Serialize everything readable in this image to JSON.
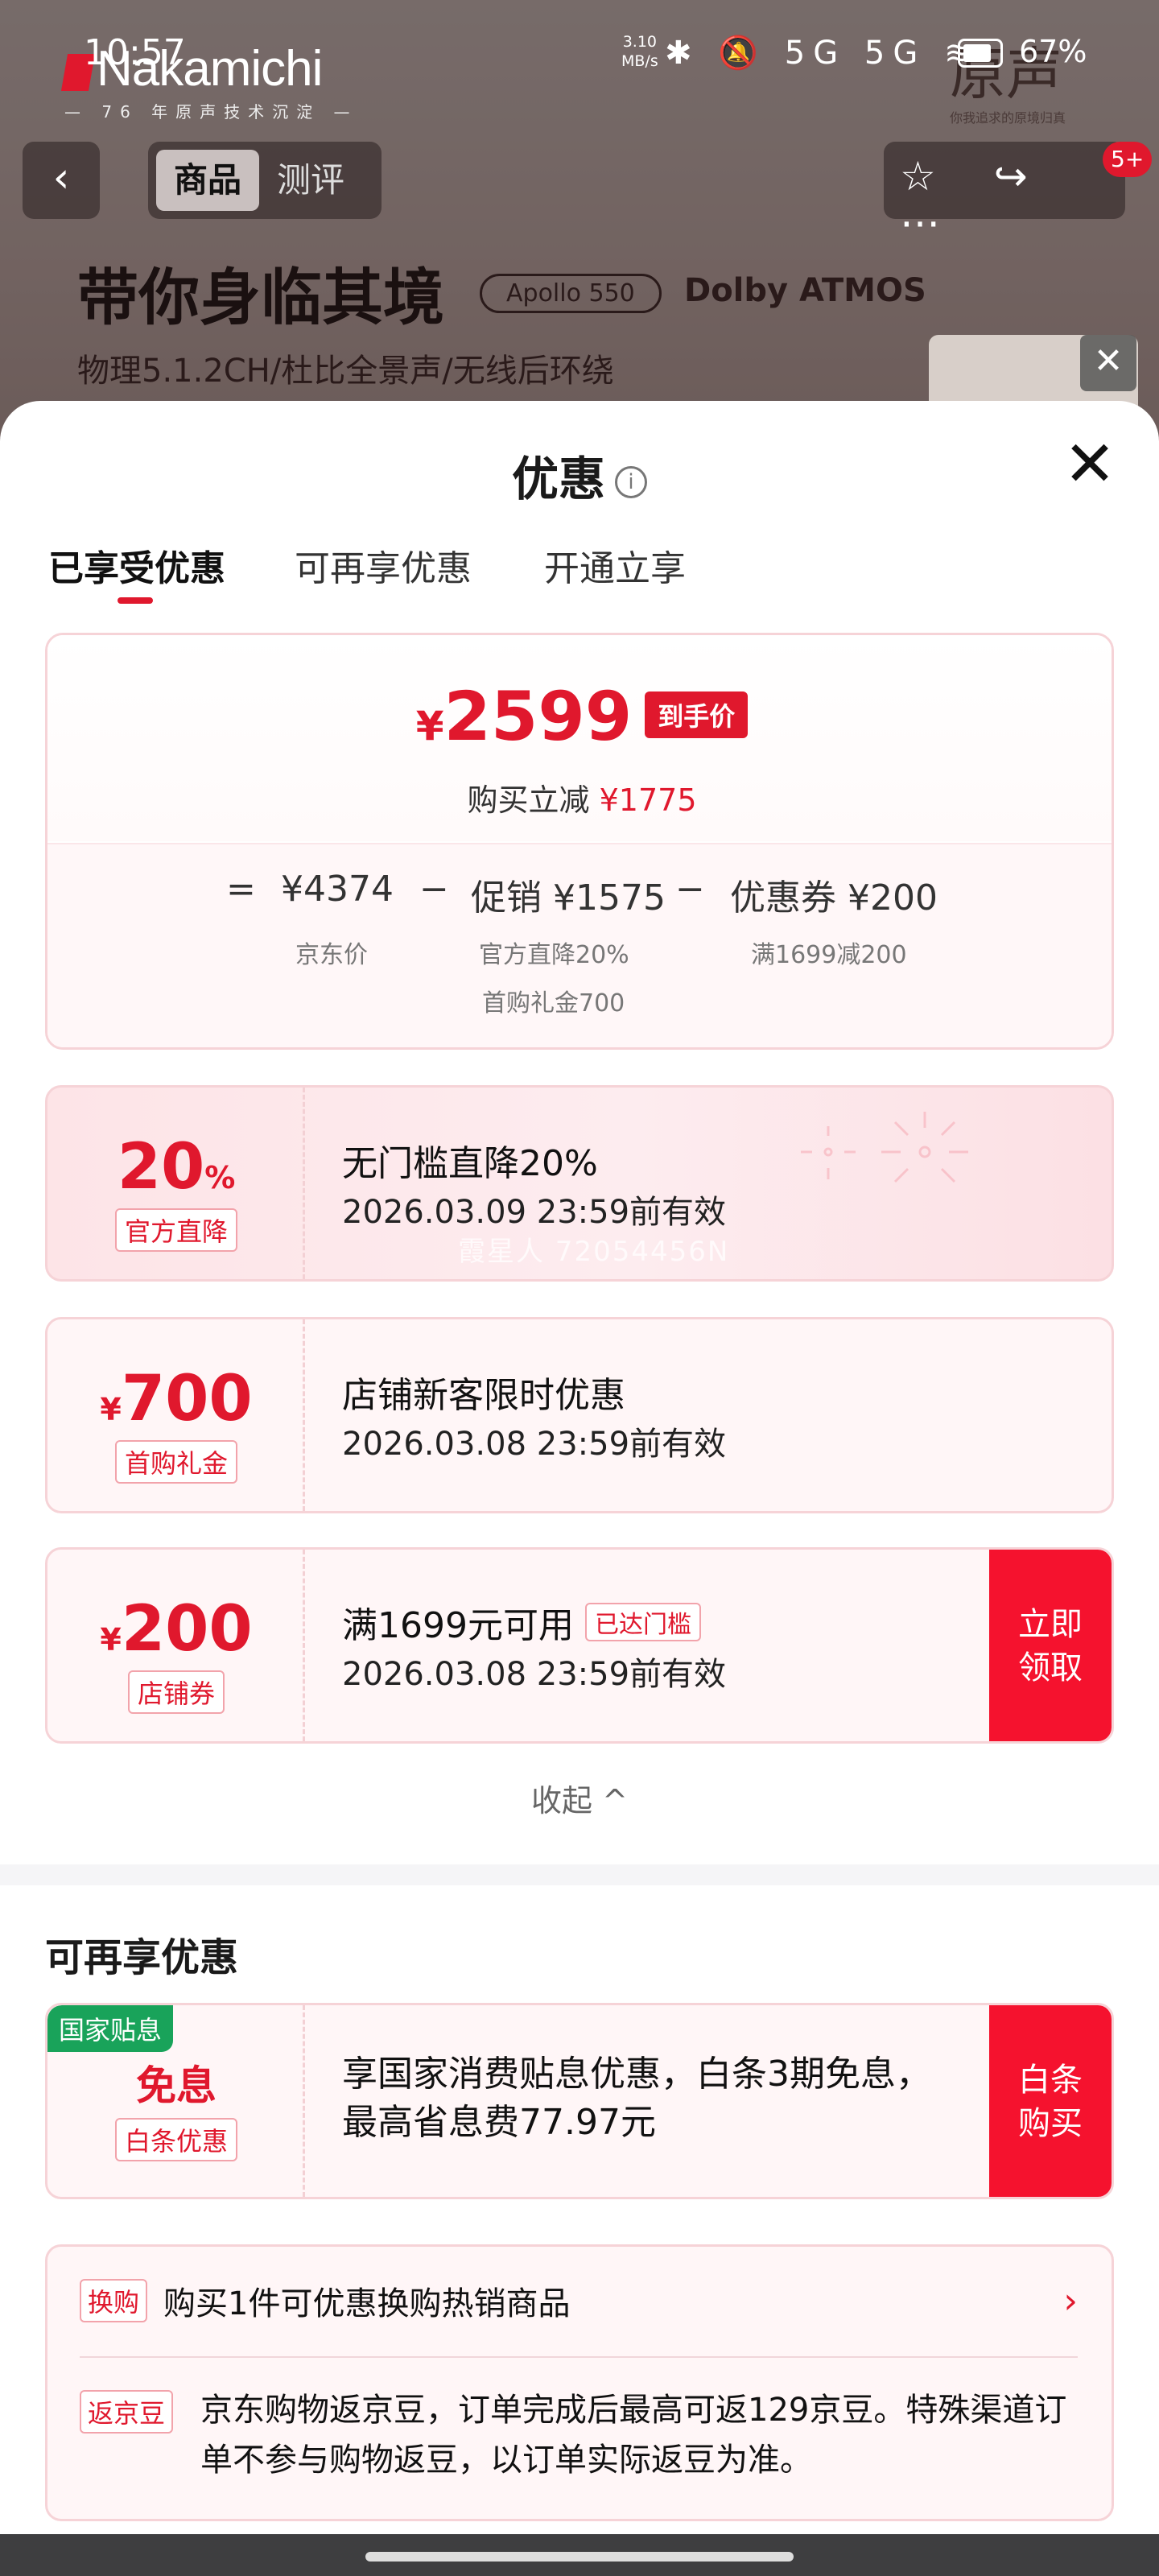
{
  "status": {
    "time": "10:57",
    "net_speed": "3.10\nMB/s",
    "icons": "✱ 🔕 5G 5G ≋",
    "battery": "67%"
  },
  "background": {
    "brand": "Nakamichi",
    "brand_tagline": "— 76 年原声技术沉淀 —",
    "right_brand": "原声",
    "right_slogan": "你我追求的原境归真",
    "nav_tabs": [
      "商品",
      "测评"
    ],
    "nav_back": "‹",
    "nav_icons": "☆ ↪ ⋯",
    "badge": "5+",
    "headline": "带你身临其境",
    "model": "Apollo 550",
    "dolby": "Dolby ATMOS",
    "subline": "物理5.1.2CH/杜比全景声/无线后环绕",
    "thumb_close": "✕"
  },
  "sheet": {
    "title": "优惠",
    "info_icon": "i",
    "close_icon": "✕",
    "tabs": [
      "已享受优惠",
      "可再享优惠",
      "开通立享"
    ],
    "summary": {
      "currency": "¥",
      "final_price": "2599",
      "price_tag": "到手价",
      "reduce_label": "购买立减",
      "reduce_amount": "¥1775",
      "eq": "=",
      "jd_price": "¥4374",
      "minus1": "−",
      "promo": "促销 ¥1575",
      "minus2": "−",
      "coupon": "优惠券 ¥200",
      "jd_price_label": "京东价",
      "promo_detail1": "官方直降20%",
      "promo_detail2": "首购礼金700",
      "coupon_detail": "满1699减200"
    },
    "coupons": [
      {
        "big": "20",
        "unit": "%",
        "tag": "官方直降",
        "title": "无门槛直降20%",
        "validity": "2026.03.09 23:59前有效"
      },
      {
        "cur": "¥",
        "big": "700",
        "tag": "首购礼金",
        "title": "店铺新客限时优惠",
        "validity": "2026.03.08 23:59前有效"
      },
      {
        "cur": "¥",
        "big": "200",
        "tag": "店铺券",
        "title": "满1699元可用",
        "mini": "已达门槛",
        "validity": "2026.03.08 23:59前有效",
        "cta": "立即\n领取"
      }
    ],
    "watermark": "霞星人 72054456N",
    "collapse": "收起 ^",
    "section2_title": "可再享优惠",
    "subsidy": {
      "corner": "国家贴息",
      "big": "免息",
      "tag": "白条优惠",
      "text": "享国家消费贴息优惠，白条3期免息，最高省息费77.97元",
      "cta": "白条\n购买"
    },
    "exchange": {
      "badge1": "换购",
      "text1": "购买1件可优惠换购热销商品",
      "chevron": "›",
      "badge2": "返京豆",
      "text2": "京东购物返京豆，订单完成后最高可返129京豆。特殊渠道订单不参与购物返豆，以订单实际返豆为准。"
    }
  },
  "colors": {
    "accent": "#e0182d",
    "cta": "#f5122e",
    "subsidy_green": "#19a35a"
  }
}
